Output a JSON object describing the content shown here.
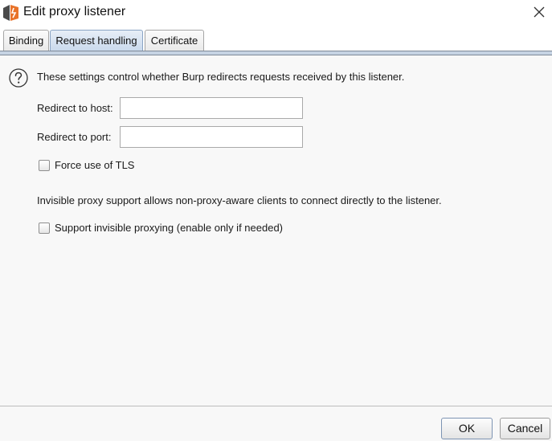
{
  "window": {
    "title": "Edit proxy listener"
  },
  "tabs": [
    {
      "label": "Binding",
      "active": false
    },
    {
      "label": "Request handling",
      "active": true
    },
    {
      "label": "Certificate",
      "active": false
    }
  ],
  "request_handling": {
    "description": "These settings control whether Burp redirects requests received by this listener.",
    "redirect_host_label": "Redirect to host:",
    "redirect_host_value": "",
    "redirect_port_label": "Redirect to port:",
    "redirect_port_value": "",
    "force_tls_label": "Force use of TLS",
    "force_tls_checked": false,
    "invisible_description": "Invisible proxy support allows non-proxy-aware clients to connect directly to the listener.",
    "invisible_label": "Support invisible proxying (enable only if needed)",
    "invisible_checked": false
  },
  "buttons": {
    "ok": "OK",
    "cancel": "Cancel"
  },
  "colors": {
    "active_tab": "#c9d9ec",
    "app_icon_orange": "#e8732a",
    "app_icon_dark": "#4a4a4a"
  },
  "icons": {
    "app": "burp-app-icon",
    "close": "close-icon",
    "help": "help-icon"
  }
}
